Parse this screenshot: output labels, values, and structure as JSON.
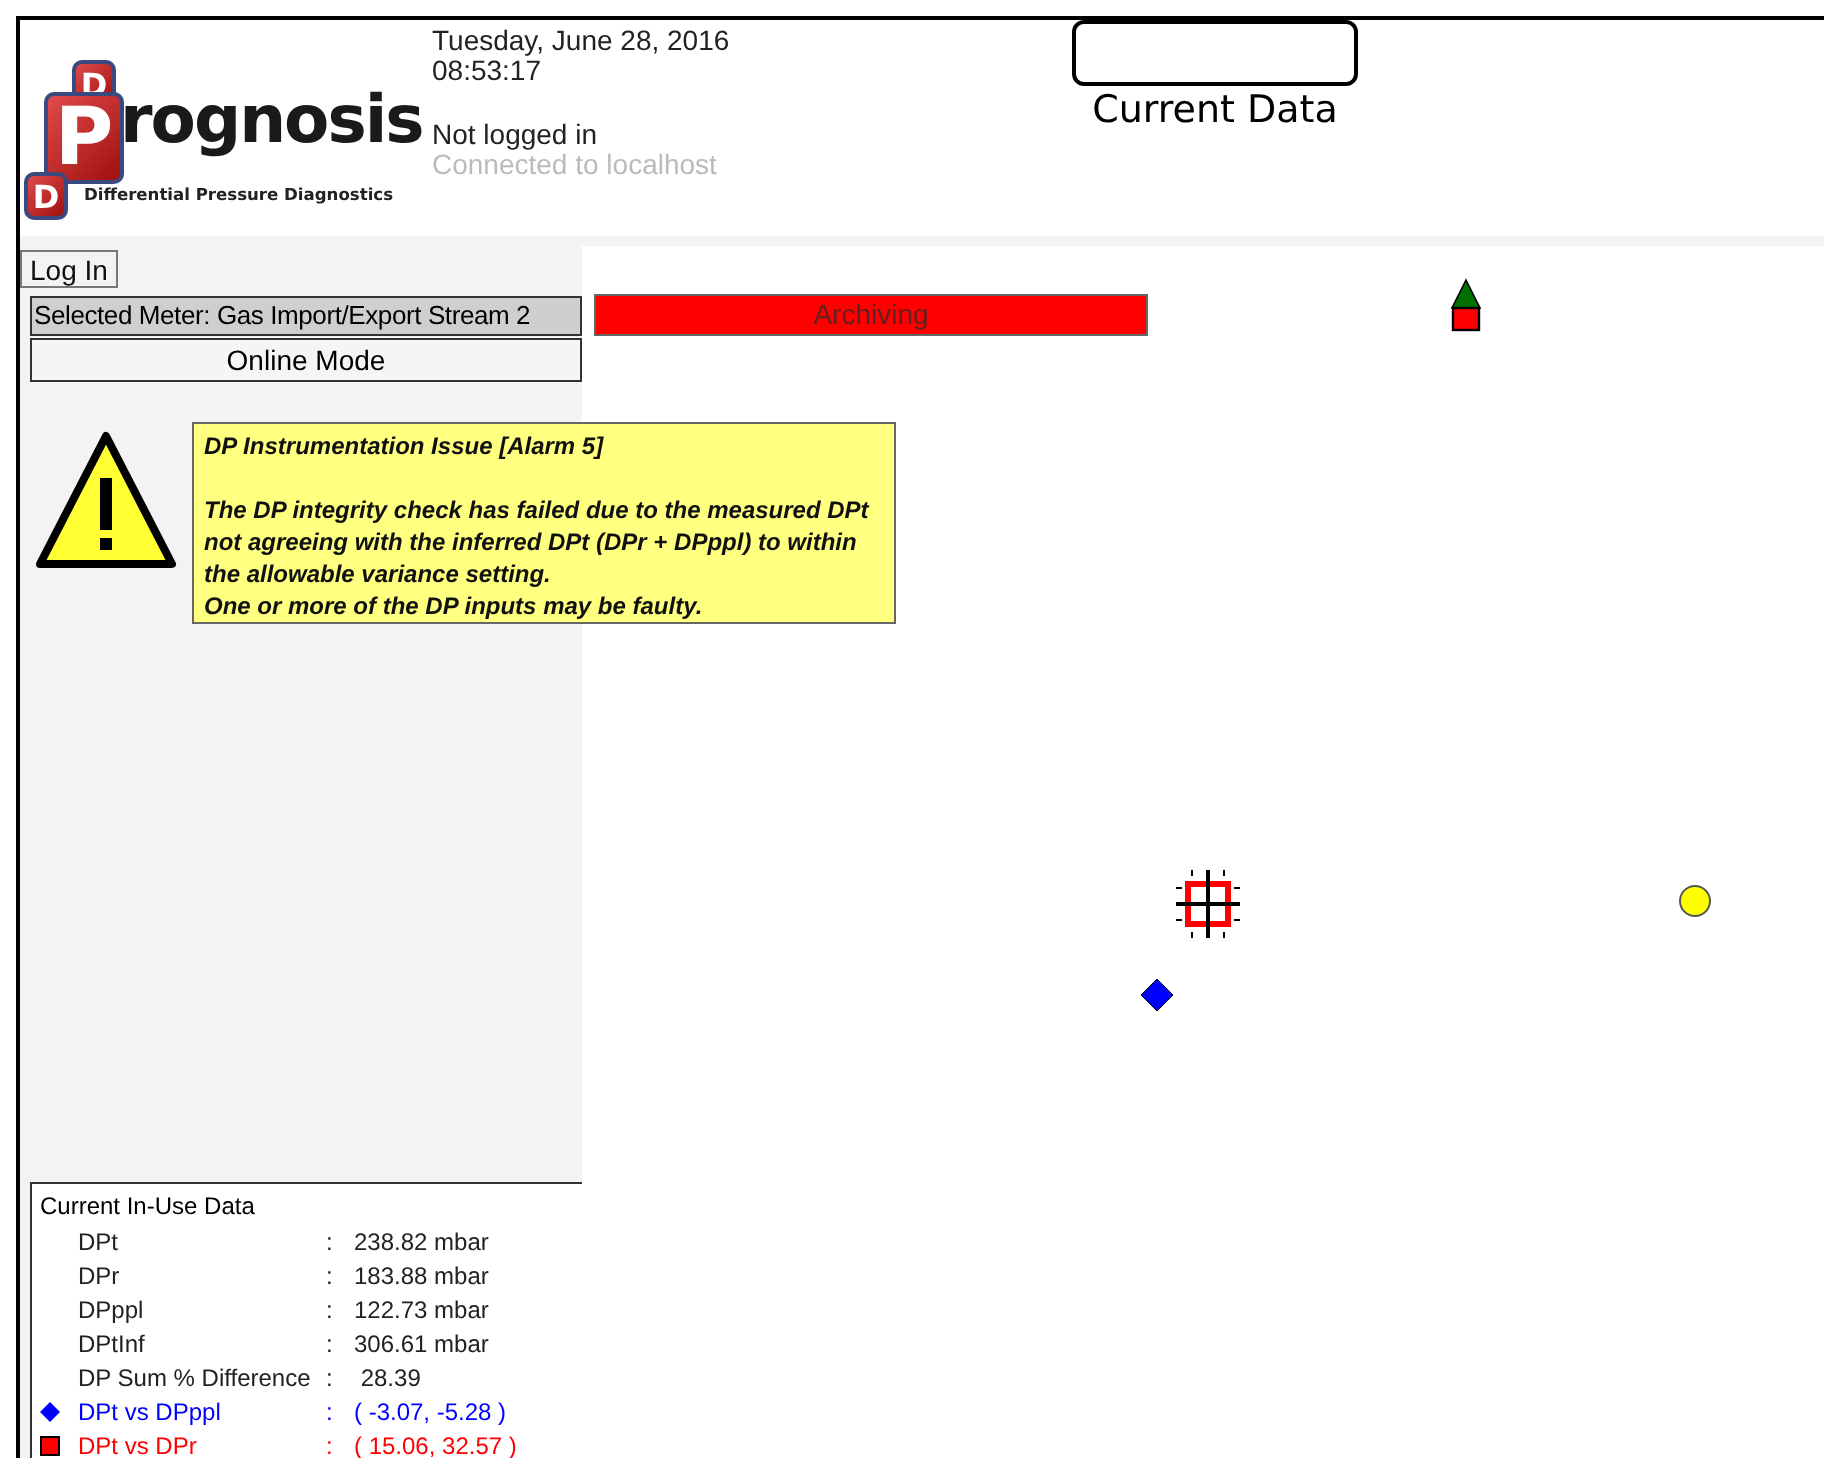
{
  "header": {
    "logo": {
      "top_letter": "D",
      "bottom_letter": "D",
      "initial": "P",
      "rest": "rognosis",
      "tagline": "Differential Pressure Diagnostics"
    },
    "date": "Tuesday, June 28, 2016",
    "time": "08:53:17",
    "login_status": "Not logged in",
    "connection": "Connected to localhost",
    "view_title": "Current Data"
  },
  "sidebar": {
    "login_button": "Log In",
    "selected_meter": "Selected Meter: Gas Import/Export Stream 2",
    "mode": "Online Mode"
  },
  "alarm": {
    "title": "DP Instrumentation Issue [Alarm 5]",
    "lines": [
      "The DP integrity check has failed due to the measured DPt",
      "not agreeing with the inferred DPt (DPr + DPppl) to within",
      "the allowable variance setting.",
      "One or more of the DP inputs may be faulty."
    ]
  },
  "status_bar": {
    "label": "Archiving"
  },
  "in_use_data": {
    "title": "Current In-Use Data",
    "rows": [
      {
        "kind": "plain",
        "label": "DPt",
        "separator": ":",
        "value": "238.82 mbar"
      },
      {
        "kind": "plain",
        "label": "DPr",
        "separator": ":",
        "value": "183.88 mbar"
      },
      {
        "kind": "plain",
        "label": "DPppl",
        "separator": ":",
        "value": "122.73 mbar"
      },
      {
        "kind": "plain",
        "label": "DPtInf",
        "separator": ":",
        "value": "306.61 mbar"
      },
      {
        "kind": "plain",
        "label": "DP Sum % Difference",
        "separator": ":",
        "value": " 28.39"
      },
      {
        "kind": "diamond",
        "color": "#0000ff",
        "label": "DPt vs DPppl",
        "separator": ":",
        "value": "( -3.07, -5.28 )"
      },
      {
        "kind": "square",
        "color": "#ff0000",
        "label": "DPt vs DPr",
        "separator": ":",
        "value": "( 15.06, 32.57 )"
      }
    ]
  }
}
